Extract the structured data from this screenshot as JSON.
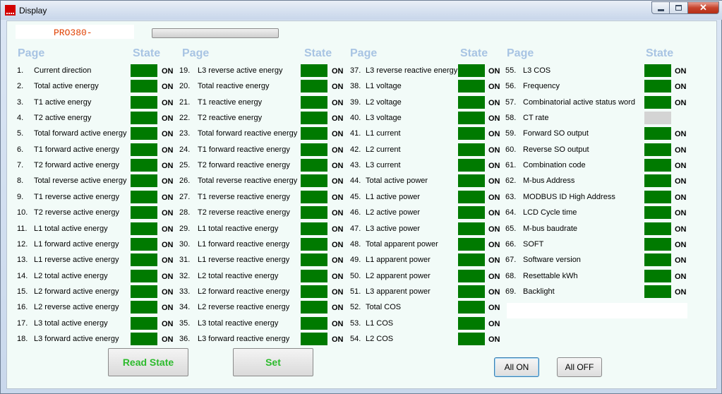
{
  "window": {
    "title": "Display"
  },
  "model": {
    "name": "PRO380-"
  },
  "headers": {
    "page": "Page",
    "state": "State"
  },
  "state_on_label": "ON",
  "colors": {
    "state_on": "#007a00",
    "state_off": "#d4d4d4",
    "header": "#a8c4e3",
    "button_text": "#2dbb2d"
  },
  "columns": [
    [
      {
        "num": "1.",
        "label": "Current direction",
        "state": "ON"
      },
      {
        "num": "2.",
        "label": "Total active energy",
        "state": "ON"
      },
      {
        "num": "3.",
        "label": "T1 active energy",
        "state": "ON"
      },
      {
        "num": "4.",
        "label": "T2 active energy",
        "state": "ON"
      },
      {
        "num": "5.",
        "label": "Total forward active energy",
        "state": "ON"
      },
      {
        "num": "6.",
        "label": "T1 forward active energy",
        "state": "ON"
      },
      {
        "num": "7.",
        "label": "T2 forward active energy",
        "state": "ON"
      },
      {
        "num": "8.",
        "label": "Total reverse active energy",
        "state": "ON"
      },
      {
        "num": "9.",
        "label": "T1 reverse active energy",
        "state": "ON"
      },
      {
        "num": "10.",
        "label": "T2 reverse active energy",
        "state": "ON"
      },
      {
        "num": "11.",
        "label": "L1 total active energy",
        "state": "ON"
      },
      {
        "num": "12.",
        "label": "L1 forward active energy",
        "state": "ON"
      },
      {
        "num": "13.",
        "label": "L1 reverse active energy",
        "state": "ON"
      },
      {
        "num": "14.",
        "label": "L2 total active energy",
        "state": "ON"
      },
      {
        "num": "15.",
        "label": "L2 forward active energy",
        "state": "ON"
      },
      {
        "num": "16.",
        "label": "L2 reverse active energy",
        "state": "ON"
      },
      {
        "num": "17.",
        "label": "L3 total active energy",
        "state": "ON"
      },
      {
        "num": "18.",
        "label": "L3 forward active energy",
        "state": "ON"
      }
    ],
    [
      {
        "num": "19.",
        "label": "L3 reverse active energy",
        "state": "ON"
      },
      {
        "num": "20.",
        "label": "Total reactive energy",
        "state": "ON"
      },
      {
        "num": "21.",
        "label": "T1 reactive energy",
        "state": "ON"
      },
      {
        "num": "22.",
        "label": "T2 reactive energy",
        "state": "ON"
      },
      {
        "num": "23.",
        "label": "Total forward reactive energy",
        "state": "ON"
      },
      {
        "num": "24.",
        "label": "T1 forward reactive energy",
        "state": "ON"
      },
      {
        "num": "25.",
        "label": "T2 forward reactive energy",
        "state": "ON"
      },
      {
        "num": "26.",
        "label": "Total reverse reactive energy",
        "state": "ON"
      },
      {
        "num": "27.",
        "label": "T1 reverse reactive energy",
        "state": "ON"
      },
      {
        "num": "28.",
        "label": "T2 reverse reactive energy",
        "state": "ON"
      },
      {
        "num": "29.",
        "label": "L1 total reactive energy",
        "state": "ON"
      },
      {
        "num": "30.",
        "label": "L1 forward reactive energy",
        "state": "ON"
      },
      {
        "num": "31.",
        "label": "L1 reverse reactive energy",
        "state": "ON"
      },
      {
        "num": "32.",
        "label": "L2 total reactive energy",
        "state": "ON"
      },
      {
        "num": "33.",
        "label": "L2 forward reactive energy",
        "state": "ON"
      },
      {
        "num": "34.",
        "label": "L2 reverse reactive energy",
        "state": "ON"
      },
      {
        "num": "35.",
        "label": "L3 total reactive energy",
        "state": "ON"
      },
      {
        "num": "36.",
        "label": "L3 forward reactive energy",
        "state": "ON"
      }
    ],
    [
      {
        "num": "37.",
        "label": "L3 reverse reactive energy",
        "state": "ON"
      },
      {
        "num": "38.",
        "label": "L1 voltage",
        "state": "ON"
      },
      {
        "num": "39.",
        "label": "L2 voltage",
        "state": "ON"
      },
      {
        "num": "40.",
        "label": "L3 voltage",
        "state": "ON"
      },
      {
        "num": "41.",
        "label": "L1 current",
        "state": "ON"
      },
      {
        "num": "42.",
        "label": "L2 current",
        "state": "ON"
      },
      {
        "num": "43.",
        "label": "L3 current",
        "state": "ON"
      },
      {
        "num": "44.",
        "label": "Total active power",
        "state": "ON"
      },
      {
        "num": "45.",
        "label": "L1 active power",
        "state": "ON"
      },
      {
        "num": "46.",
        "label": "L2 active power",
        "state": "ON"
      },
      {
        "num": "47.",
        "label": "L3 active power",
        "state": "ON"
      },
      {
        "num": "48.",
        "label": "Total apparent power",
        "state": "ON"
      },
      {
        "num": "49.",
        "label": "L1 apparent power",
        "state": "ON"
      },
      {
        "num": "50.",
        "label": "L2 apparent power",
        "state": "ON"
      },
      {
        "num": "51.",
        "label": "L3 apparent power",
        "state": "ON"
      },
      {
        "num": "52.",
        "label": "Total COS",
        "state": "ON"
      },
      {
        "num": "53.",
        "label": "L1 COS",
        "state": "ON"
      },
      {
        "num": "54.",
        "label": "L2 COS",
        "state": "ON"
      }
    ],
    [
      {
        "num": "55.",
        "label": "L3 COS",
        "state": "ON"
      },
      {
        "num": "56.",
        "label": "Frequency",
        "state": "ON"
      },
      {
        "num": "57.",
        "label": "Combinatorial active status word",
        "state": "ON"
      },
      {
        "num": "58.",
        "label": "CT rate",
        "state": ""
      },
      {
        "num": "59.",
        "label": "Forward SO output",
        "state": "ON"
      },
      {
        "num": "60.",
        "label": "Reverse SO output",
        "state": "ON"
      },
      {
        "num": "61.",
        "label": "Combination code",
        "state": "ON"
      },
      {
        "num": "62.",
        "label": "M-bus Address",
        "state": "ON"
      },
      {
        "num": "63.",
        "label": "MODBUS ID    High Address",
        "state": "ON"
      },
      {
        "num": "64.",
        "label": "LCD Cycle time",
        "state": "ON"
      },
      {
        "num": "65.",
        "label": "M-bus baudrate",
        "state": "ON"
      },
      {
        "num": "66.",
        "label": "SOFT",
        "state": "ON"
      },
      {
        "num": "67.",
        "label": "Software version",
        "state": "ON"
      },
      {
        "num": "68.",
        "label": "Resettable kWh",
        "state": "ON"
      },
      {
        "num": "69.",
        "label": "Backlight",
        "state": "ON"
      }
    ]
  ],
  "buttons": {
    "read_state": "Read State",
    "set": "Set",
    "all_on": "All ON",
    "all_off": "All OFF"
  }
}
